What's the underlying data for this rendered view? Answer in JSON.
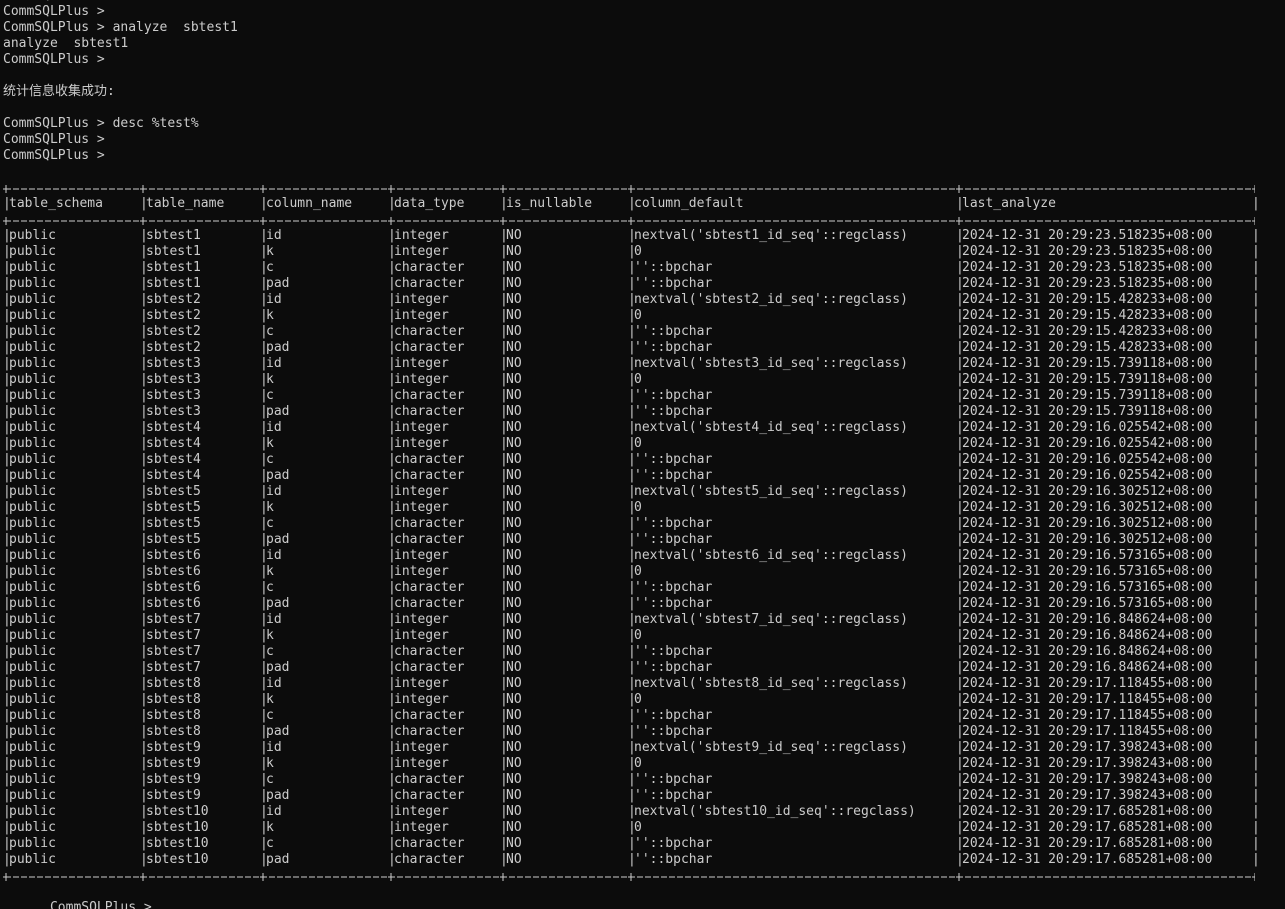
{
  "session": {
    "top_lines": [
      "CommSQLPlus >",
      "CommSQLPlus >",
      "CommSQLPlus > analyze  sbtest1",
      "analyze  sbtest1",
      "CommSQLPlus >",
      "",
      "统计信息收集成功:",
      "",
      "CommSQLPlus > desc %test%",
      "CommSQLPlus >",
      "CommSQLPlus >",
      ""
    ],
    "final_prompt": "CommSQLPlus >"
  },
  "result_table": {
    "columns": [
      "table_schema",
      "table_name",
      "column_name",
      "data_type",
      "is_nullable",
      "column_default",
      "last_analyze"
    ],
    "rows": [
      [
        "public",
        "sbtest1",
        "id",
        "integer",
        "NO",
        "nextval('sbtest1_id_seq'::regclass)",
        "2024-12-31 20:29:23.518235+08:00"
      ],
      [
        "public",
        "sbtest1",
        "k",
        "integer",
        "NO",
        "0",
        "2024-12-31 20:29:23.518235+08:00"
      ],
      [
        "public",
        "sbtest1",
        "c",
        "character",
        "NO",
        "''::bpchar",
        "2024-12-31 20:29:23.518235+08:00"
      ],
      [
        "public",
        "sbtest1",
        "pad",
        "character",
        "NO",
        "''::bpchar",
        "2024-12-31 20:29:23.518235+08:00"
      ],
      [
        "public",
        "sbtest2",
        "id",
        "integer",
        "NO",
        "nextval('sbtest2_id_seq'::regclass)",
        "2024-12-31 20:29:15.428233+08:00"
      ],
      [
        "public",
        "sbtest2",
        "k",
        "integer",
        "NO",
        "0",
        "2024-12-31 20:29:15.428233+08:00"
      ],
      [
        "public",
        "sbtest2",
        "c",
        "character",
        "NO",
        "''::bpchar",
        "2024-12-31 20:29:15.428233+08:00"
      ],
      [
        "public",
        "sbtest2",
        "pad",
        "character",
        "NO",
        "''::bpchar",
        "2024-12-31 20:29:15.428233+08:00"
      ],
      [
        "public",
        "sbtest3",
        "id",
        "integer",
        "NO",
        "nextval('sbtest3_id_seq'::regclass)",
        "2024-12-31 20:29:15.739118+08:00"
      ],
      [
        "public",
        "sbtest3",
        "k",
        "integer",
        "NO",
        "0",
        "2024-12-31 20:29:15.739118+08:00"
      ],
      [
        "public",
        "sbtest3",
        "c",
        "character",
        "NO",
        "''::bpchar",
        "2024-12-31 20:29:15.739118+08:00"
      ],
      [
        "public",
        "sbtest3",
        "pad",
        "character",
        "NO",
        "''::bpchar",
        "2024-12-31 20:29:15.739118+08:00"
      ],
      [
        "public",
        "sbtest4",
        "id",
        "integer",
        "NO",
        "nextval('sbtest4_id_seq'::regclass)",
        "2024-12-31 20:29:16.025542+08:00"
      ],
      [
        "public",
        "sbtest4",
        "k",
        "integer",
        "NO",
        "0",
        "2024-12-31 20:29:16.025542+08:00"
      ],
      [
        "public",
        "sbtest4",
        "c",
        "character",
        "NO",
        "''::bpchar",
        "2024-12-31 20:29:16.025542+08:00"
      ],
      [
        "public",
        "sbtest4",
        "pad",
        "character",
        "NO",
        "''::bpchar",
        "2024-12-31 20:29:16.025542+08:00"
      ],
      [
        "public",
        "sbtest5",
        "id",
        "integer",
        "NO",
        "nextval('sbtest5_id_seq'::regclass)",
        "2024-12-31 20:29:16.302512+08:00"
      ],
      [
        "public",
        "sbtest5",
        "k",
        "integer",
        "NO",
        "0",
        "2024-12-31 20:29:16.302512+08:00"
      ],
      [
        "public",
        "sbtest5",
        "c",
        "character",
        "NO",
        "''::bpchar",
        "2024-12-31 20:29:16.302512+08:00"
      ],
      [
        "public",
        "sbtest5",
        "pad",
        "character",
        "NO",
        "''::bpchar",
        "2024-12-31 20:29:16.302512+08:00"
      ],
      [
        "public",
        "sbtest6",
        "id",
        "integer",
        "NO",
        "nextval('sbtest6_id_seq'::regclass)",
        "2024-12-31 20:29:16.573165+08:00"
      ],
      [
        "public",
        "sbtest6",
        "k",
        "integer",
        "NO",
        "0",
        "2024-12-31 20:29:16.573165+08:00"
      ],
      [
        "public",
        "sbtest6",
        "c",
        "character",
        "NO",
        "''::bpchar",
        "2024-12-31 20:29:16.573165+08:00"
      ],
      [
        "public",
        "sbtest6",
        "pad",
        "character",
        "NO",
        "''::bpchar",
        "2024-12-31 20:29:16.573165+08:00"
      ],
      [
        "public",
        "sbtest7",
        "id",
        "integer",
        "NO",
        "nextval('sbtest7_id_seq'::regclass)",
        "2024-12-31 20:29:16.848624+08:00"
      ],
      [
        "public",
        "sbtest7",
        "k",
        "integer",
        "NO",
        "0",
        "2024-12-31 20:29:16.848624+08:00"
      ],
      [
        "public",
        "sbtest7",
        "c",
        "character",
        "NO",
        "''::bpchar",
        "2024-12-31 20:29:16.848624+08:00"
      ],
      [
        "public",
        "sbtest7",
        "pad",
        "character",
        "NO",
        "''::bpchar",
        "2024-12-31 20:29:16.848624+08:00"
      ],
      [
        "public",
        "sbtest8",
        "id",
        "integer",
        "NO",
        "nextval('sbtest8_id_seq'::regclass)",
        "2024-12-31 20:29:17.118455+08:00"
      ],
      [
        "public",
        "sbtest8",
        "k",
        "integer",
        "NO",
        "0",
        "2024-12-31 20:29:17.118455+08:00"
      ],
      [
        "public",
        "sbtest8",
        "c",
        "character",
        "NO",
        "''::bpchar",
        "2024-12-31 20:29:17.118455+08:00"
      ],
      [
        "public",
        "sbtest8",
        "pad",
        "character",
        "NO",
        "''::bpchar",
        "2024-12-31 20:29:17.118455+08:00"
      ],
      [
        "public",
        "sbtest9",
        "id",
        "integer",
        "NO",
        "nextval('sbtest9_id_seq'::regclass)",
        "2024-12-31 20:29:17.398243+08:00"
      ],
      [
        "public",
        "sbtest9",
        "k",
        "integer",
        "NO",
        "0",
        "2024-12-31 20:29:17.398243+08:00"
      ],
      [
        "public",
        "sbtest9",
        "c",
        "character",
        "NO",
        "''::bpchar",
        "2024-12-31 20:29:17.398243+08:00"
      ],
      [
        "public",
        "sbtest9",
        "pad",
        "character",
        "NO",
        "''::bpchar",
        "2024-12-31 20:29:17.398243+08:00"
      ],
      [
        "public",
        "sbtest10",
        "id",
        "integer",
        "NO",
        "nextval('sbtest10_id_seq'::regclass)",
        "2024-12-31 20:29:17.685281+08:00"
      ],
      [
        "public",
        "sbtest10",
        "k",
        "integer",
        "NO",
        "0",
        "2024-12-31 20:29:17.685281+08:00"
      ],
      [
        "public",
        "sbtest10",
        "c",
        "character",
        "NO",
        "''::bpchar",
        "2024-12-31 20:29:17.685281+08:00"
      ],
      [
        "public",
        "sbtest10",
        "pad",
        "character",
        "NO",
        "''::bpchar",
        "2024-12-31 20:29:17.685281+08:00"
      ]
    ]
  },
  "colors": {
    "background": "#0c0c0c",
    "text": "#cccccc"
  }
}
